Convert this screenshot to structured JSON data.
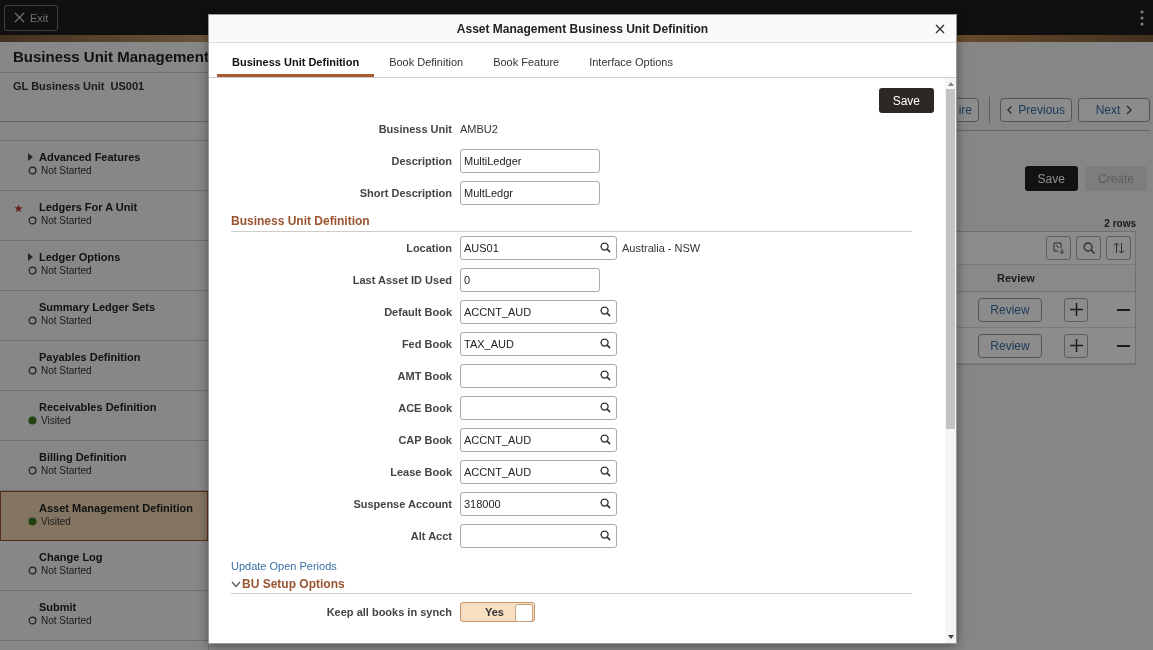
{
  "topbar": {
    "exit_button": "Exit"
  },
  "page": {
    "title": "Business Unit Management",
    "context_label": "GL Business Unit",
    "context_value": "US001"
  },
  "steps": [
    {
      "title": "Advanced Features",
      "status": "Not Started",
      "kind": "not_started",
      "expandable": true,
      "required": false,
      "selected": false
    },
    {
      "title": "Ledgers For A Unit",
      "status": "Not Started",
      "kind": "not_started",
      "expandable": false,
      "required": true,
      "selected": false
    },
    {
      "title": "Ledger Options",
      "status": "Not Started",
      "kind": "not_started",
      "expandable": true,
      "required": false,
      "selected": false
    },
    {
      "title": "Summary Ledger Sets",
      "status": "Not Started",
      "kind": "not_started",
      "expandable": false,
      "required": false,
      "selected": false
    },
    {
      "title": "Payables Definition",
      "status": "Not Started",
      "kind": "not_started",
      "expandable": false,
      "required": false,
      "selected": false
    },
    {
      "title": "Receivables Definition",
      "status": "Visited",
      "kind": "visited",
      "expandable": false,
      "required": false,
      "selected": false
    },
    {
      "title": "Billing Definition",
      "status": "Not Started",
      "kind": "not_started",
      "expandable": false,
      "required": false,
      "selected": false
    },
    {
      "title": "Asset Management Definition",
      "status": "Visited",
      "kind": "visited",
      "expandable": false,
      "required": false,
      "selected": true
    },
    {
      "title": "Change Log",
      "status": "Not Started",
      "kind": "not_started",
      "expandable": false,
      "required": false,
      "selected": false
    },
    {
      "title": "Submit",
      "status": "Not Started",
      "kind": "not_started",
      "expandable": false,
      "required": false,
      "selected": false
    }
  ],
  "nav": {
    "partial_button": "ire",
    "previous": "Previous",
    "next": "Next"
  },
  "actions": [
    {
      "label": "Save",
      "disabled": false
    },
    {
      "label": "Create",
      "disabled": true
    }
  ],
  "grid": {
    "row_count": "2 rows",
    "column": "Review",
    "rows": [
      {
        "review": "Review"
      },
      {
        "review": "Review"
      }
    ]
  },
  "modal": {
    "title": "Asset Management Business Unit Definition",
    "tabs": [
      {
        "label": "Business Unit Definition",
        "selected": true
      },
      {
        "label": "Book Definition",
        "selected": false
      },
      {
        "label": "Book Feature",
        "selected": false
      },
      {
        "label": "Interface Options",
        "selected": false
      }
    ],
    "save_button": "Save",
    "header_fields": [
      {
        "label": "Business Unit",
        "kind": "display",
        "value": "AMBU2"
      },
      {
        "label": "Description",
        "kind": "text",
        "value": "MultiLedger"
      },
      {
        "label": "Short Description",
        "kind": "text",
        "value": "MultLedgr"
      }
    ],
    "section": {
      "title": "Business Unit Definition",
      "fields": [
        {
          "label": "Location",
          "kind": "prompt",
          "value": "AUS01",
          "description": "Australia - NSW"
        },
        {
          "label": "Last Asset ID Used",
          "kind": "text",
          "value": "0"
        },
        {
          "label": "Default Book",
          "kind": "prompt",
          "value": "ACCNT_AUD"
        },
        {
          "label": "Fed Book",
          "kind": "prompt",
          "value": "TAX_AUD"
        },
        {
          "label": "AMT Book",
          "kind": "prompt"
        },
        {
          "label": "ACE Book",
          "kind": "prompt"
        },
        {
          "label": "CAP Book",
          "kind": "prompt",
          "value": "ACCNT_AUD"
        },
        {
          "label": "Lease Book",
          "kind": "prompt",
          "value": "ACCNT_AUD"
        },
        {
          "label": "Suspense Account",
          "kind": "prompt",
          "value": "318000"
        },
        {
          "label": "Alt Acct",
          "kind": "prompt"
        }
      ]
    },
    "link": "Update Open Periods",
    "setup": {
      "title": "BU Setup Options",
      "expanded": true,
      "toggles": [
        {
          "label": "Keep all books in synch",
          "on": true,
          "text": "Yes"
        }
      ]
    }
  }
}
